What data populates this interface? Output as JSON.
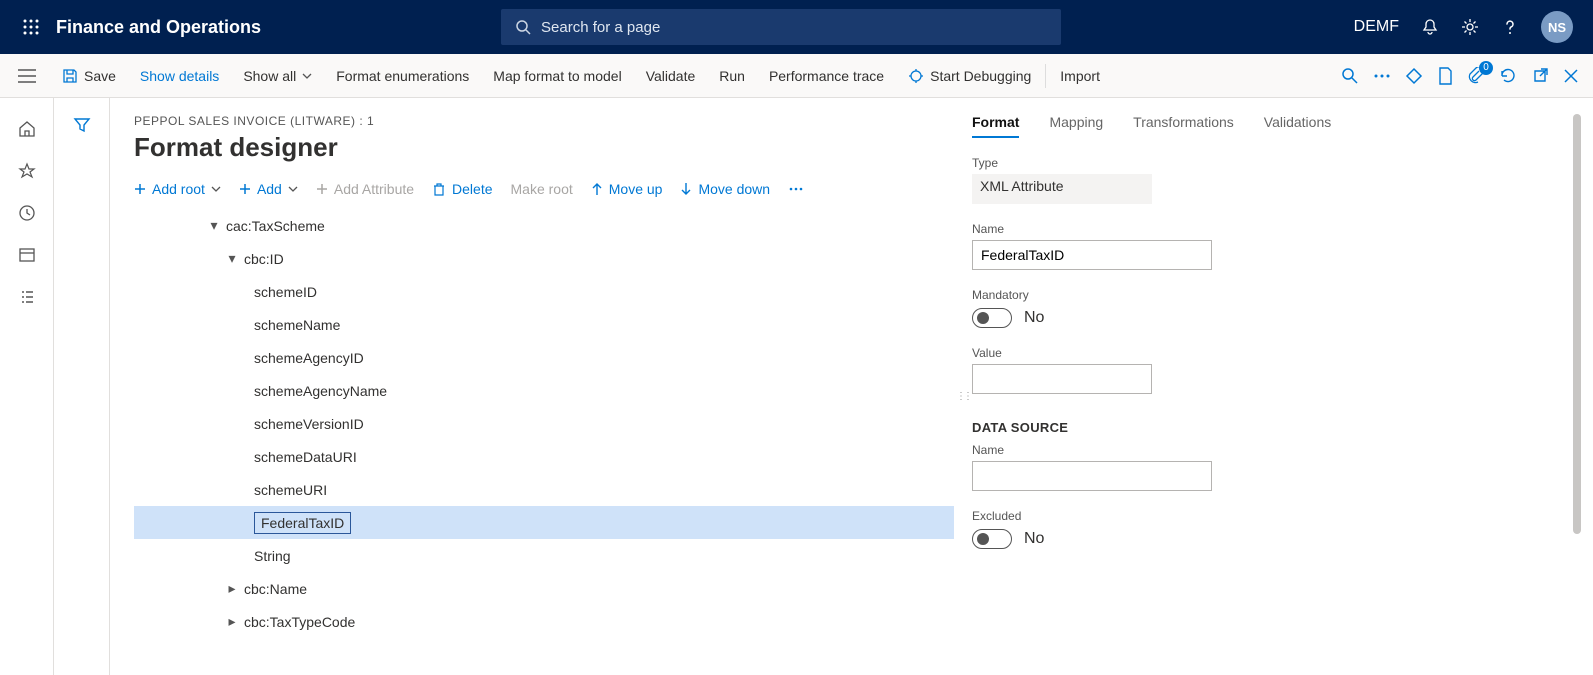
{
  "header": {
    "brand": "Finance and Operations",
    "search_placeholder": "Search for a page",
    "company": "DEMF",
    "user_initials": "NS"
  },
  "commandbar": {
    "save": "Save",
    "show_details": "Show details",
    "show_all": "Show all",
    "format_enum": "Format enumerations",
    "map_format": "Map format to model",
    "validate": "Validate",
    "run": "Run",
    "perf_trace": "Performance trace",
    "start_debug": "Start Debugging",
    "import_label": "Import",
    "attach_badge": "0"
  },
  "page": {
    "breadcrumb": "PEPPOL SALES INVOICE (LITWARE) : 1",
    "title": "Format designer"
  },
  "tree_toolbar": {
    "add_root": "Add root",
    "add": "Add",
    "add_attribute": "Add Attribute",
    "delete": "Delete",
    "make_root": "Make root",
    "move_up": "Move up",
    "move_down": "Move down"
  },
  "tree": {
    "n0": "cac:TaxScheme",
    "n1": "cbc:ID",
    "n2": "schemeID",
    "n3": "schemeName",
    "n4": "schemeAgencyID",
    "n5": "schemeAgencyName",
    "n6": "schemeVersionID",
    "n7": "schemeDataURI",
    "n8": "schemeURI",
    "n9": "FederalTaxID",
    "n10": "String",
    "n11": "cbc:Name",
    "n12": "cbc:TaxTypeCode"
  },
  "right_tabs": {
    "format": "Format",
    "mapping": "Mapping",
    "transformations": "Transformations",
    "validations": "Validations"
  },
  "props": {
    "type_label": "Type",
    "type_value": "XML Attribute",
    "name_label": "Name",
    "name_value": "FederalTaxID",
    "mandatory_label": "Mandatory",
    "mandatory_value": "No",
    "value_label": "Value",
    "value_value": "",
    "datasource_head": "DATA SOURCE",
    "ds_name_label": "Name",
    "ds_name_value": "",
    "excluded_label": "Excluded",
    "excluded_value": "No"
  }
}
